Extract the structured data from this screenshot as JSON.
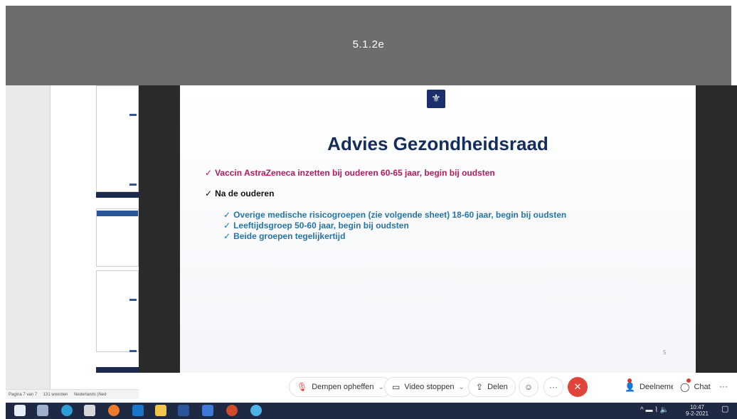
{
  "redaction": {
    "code": "5.1.2e"
  },
  "word_status": {
    "page": "Pagina 7 van 7",
    "words": "131 woorden",
    "language": "Nederlands (Ned"
  },
  "slide": {
    "title": "Advies Gezondheidsraad",
    "check_mark": "✓",
    "bullets": [
      "Vaccin AstraZeneca inzetten bij ouderen 60-65 jaar, begin bij oudsten",
      "Na de ouderen"
    ],
    "sub_bullets": [
      "Overige medische risicogroepen (zie volgende sheet) 18-60 jaar, begin bij oudsten",
      "Leeftijdsgroep 50-60 jaar, begin bij oudsten",
      "Beide groepen tegelijkertijd"
    ],
    "page_number": "5",
    "colors": {
      "title": "#142e5c",
      "bullet_primary": "#b5195a",
      "sub_bullets": "#2474a8"
    }
  },
  "meeting_controls": {
    "unmute": "Dempen opheffen",
    "stop_video": "Video stoppen",
    "share": "Delen",
    "participants": "Deelnemers",
    "chat": "Chat",
    "more": "···",
    "hangup_color": "#e0433a"
  },
  "taskbar": {
    "time": "10:47",
    "date": "9-2-2021",
    "apps": [
      "start-icon",
      "task-view-icon",
      "edge-icon",
      "store-icon",
      "firefox-icon",
      "outlook-icon",
      "file-explorer-icon",
      "word-icon",
      "app-icon",
      "powerpoint-icon",
      "chrome-icon"
    ]
  }
}
